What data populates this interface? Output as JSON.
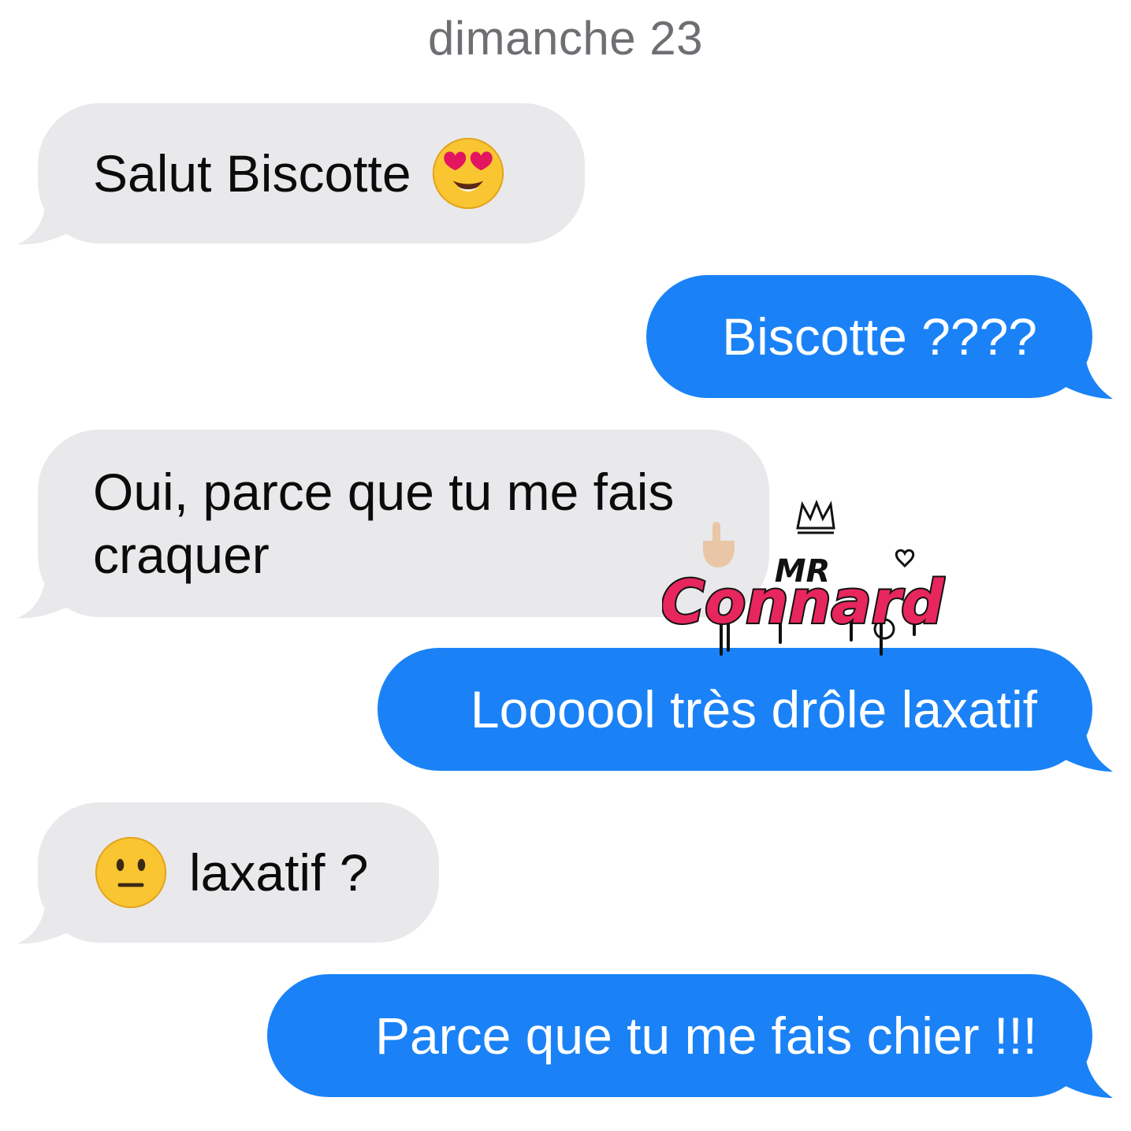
{
  "header": {
    "date": "dimanche 23"
  },
  "messages": [
    {
      "direction": "incoming",
      "text": "Salut Biscotte",
      "emoji": "heart-eyes-face",
      "emoji_position": "after"
    },
    {
      "direction": "outgoing",
      "text": "Biscotte ????"
    },
    {
      "direction": "incoming",
      "text": "Oui, parce que tu me fais\ncraquer"
    },
    {
      "direction": "outgoing",
      "text": "Loooool très drôle laxatif"
    },
    {
      "direction": "incoming",
      "text": "laxatif ?",
      "emoji": "neutral-face",
      "emoji_position": "before"
    },
    {
      "direction": "outgoing",
      "text": "Parce que tu me fais chier !!!"
    }
  ],
  "watermark": {
    "text": "MR Connard"
  },
  "colors": {
    "incoming_bubble": "#e9e9eb",
    "outgoing_bubble": "#1a82f6",
    "incoming_text": "#0b0b0b",
    "outgoing_text": "#ffffff",
    "date_text": "#6e6e73",
    "watermark_pink": "#e8265e"
  }
}
